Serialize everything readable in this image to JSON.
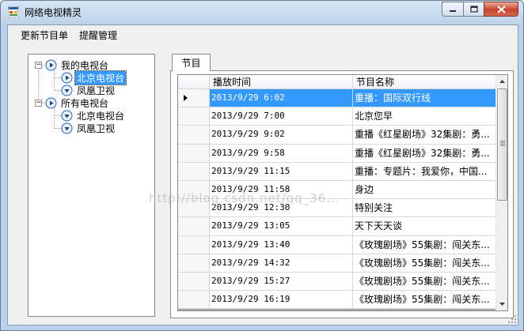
{
  "window": {
    "title": "网络电视精灵",
    "app_icon": "windows-forms-icon",
    "buttons": {
      "minimize": "minimize-icon",
      "maximize": "maximize-icon",
      "close": "close-icon"
    }
  },
  "menu": {
    "items": [
      {
        "label": "更新节目单"
      },
      {
        "label": "提醒管理"
      }
    ]
  },
  "tree": {
    "nodes": [
      {
        "label": "我的电视台",
        "expanded": true,
        "icon": "play-icon"
      },
      {
        "label": "北京电视台",
        "selected": true,
        "icon": "play-icon"
      },
      {
        "label": "凤凰卫视",
        "icon": "down-icon"
      },
      {
        "label": "所有电视台",
        "expanded": true,
        "icon": "play-icon"
      },
      {
        "label": "北京电视台",
        "icon": "down-icon"
      },
      {
        "label": "凤凰卫视",
        "icon": "down-icon"
      }
    ]
  },
  "tab": {
    "label": "节目"
  },
  "grid": {
    "columns": [
      "播放时间",
      "节目名称"
    ],
    "rows": [
      {
        "time": "2013/9/29 6:02",
        "name": "重播：国际双行线",
        "selected": true
      },
      {
        "time": "2013/9/29 7:00",
        "name": "北京您早"
      },
      {
        "time": "2013/9/29 9:02",
        "name": "重播《红星剧场》32集剧：勇..."
      },
      {
        "time": "2013/9/29 9:58",
        "name": "重播《红星剧场》32集剧：勇..."
      },
      {
        "time": "2013/9/29 11:15",
        "name": "重播：专题片：我爱你，中国..."
      },
      {
        "time": "2013/9/29 11:58",
        "name": "身边"
      },
      {
        "time": "2013/9/29 12:30",
        "name": "特别关注"
      },
      {
        "time": "2013/9/29 13:05",
        "name": "天下天天谈"
      },
      {
        "time": "2013/9/29 13:40",
        "name": "《玫瑰剧场》55集剧：闯关东..."
      },
      {
        "time": "2013/9/29 14:32",
        "name": "《玫瑰剧场》55集剧：闯关东..."
      },
      {
        "time": "2013/9/29 15:27",
        "name": "《玫瑰剧场》55集剧：闯关东..."
      },
      {
        "time": "2013/9/29 16:19",
        "name": "《玫瑰剧场》55集剧：闯关东..."
      }
    ]
  },
  "watermark": "http://blog.csdn.net/qq_36..."
}
